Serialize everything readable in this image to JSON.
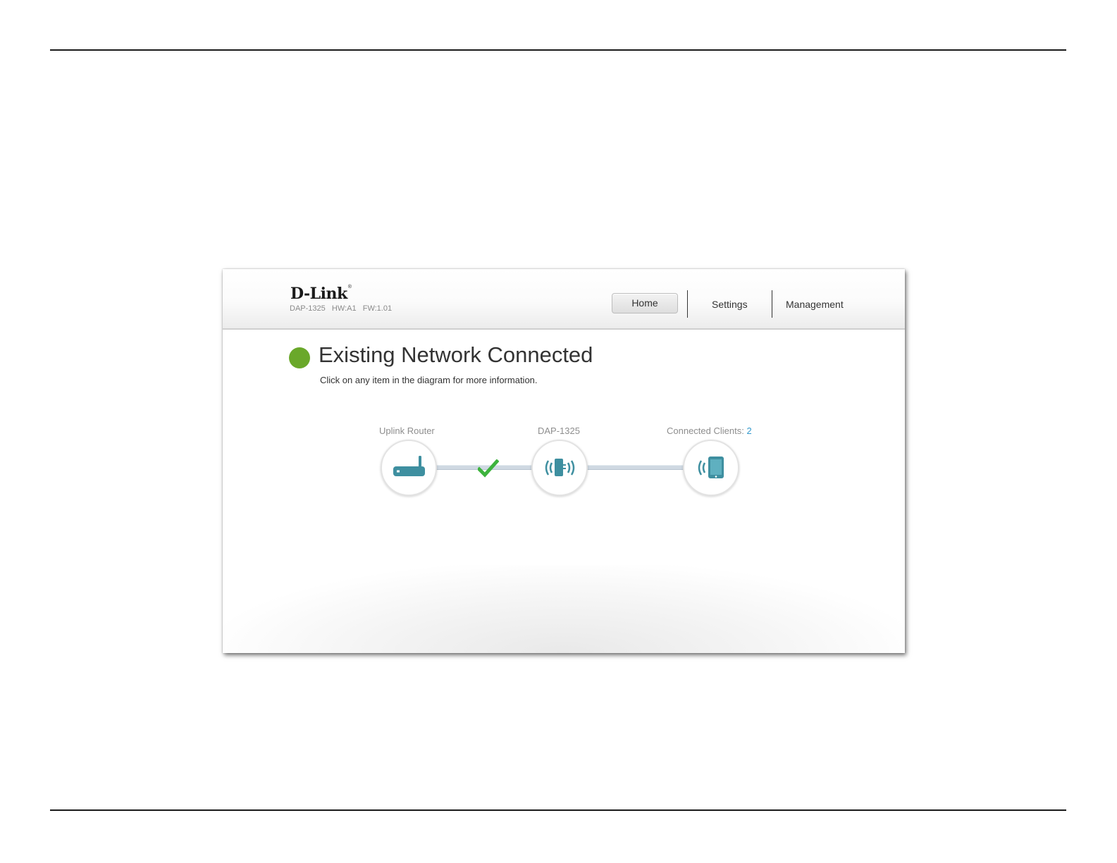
{
  "header": {
    "logo": "D-Link",
    "logo_mark": "®",
    "model_info": "DAP-1325   HW:A1   FW:1.01"
  },
  "nav": {
    "home": "Home",
    "settings": "Settings",
    "management": "Management"
  },
  "status": {
    "title": "Existing Network Connected",
    "subtitle": "Click on any item in the diagram for more information.",
    "color": "#6aa82a"
  },
  "diagram": {
    "uplink_label": "Uplink Router",
    "device_label": "DAP-1325",
    "clients_label": "Connected Clients:",
    "clients_count": "2",
    "icon_color": "#3e8fa0",
    "check_color": "#3db33d",
    "icons": [
      "router-icon",
      "extender-icon",
      "tablet-icon",
      "check-icon"
    ]
  }
}
